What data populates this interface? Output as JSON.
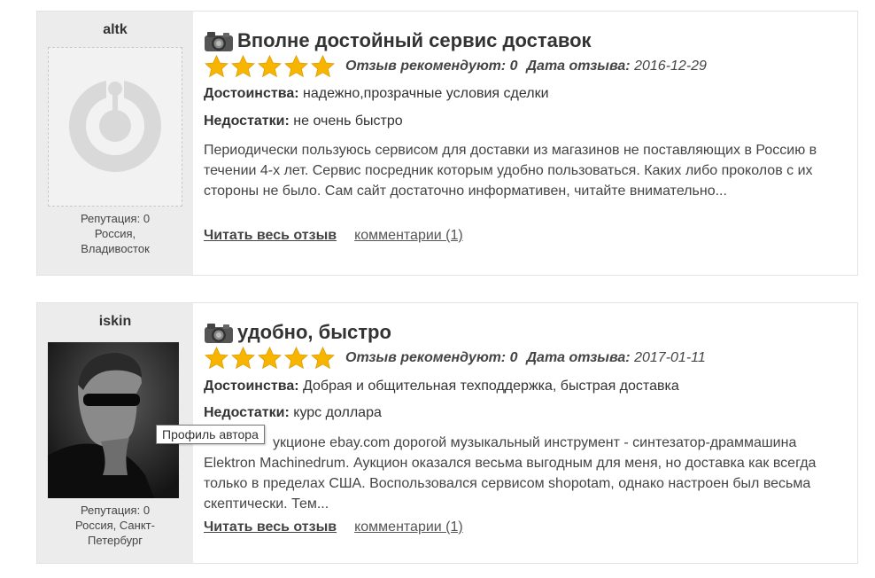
{
  "reviews": [
    {
      "author": {
        "name": "altk",
        "reputation": "Репутация: 0",
        "location": "Россия,\nВладивосток",
        "avatar": "default-avatar-icon"
      },
      "title": "Вполне достойный сервис доставок",
      "stars": 5,
      "recommend_label": "Отзыв рекомендуют:",
      "recommend_value": "0",
      "date_label": "Дата отзыва:",
      "date_value": "2016-12-29",
      "pros_label": "Достоинства:",
      "pros_value": "надежно,прозрачные условия сделки",
      "cons_label": "Недостатки:",
      "cons_value": "не очень быстро",
      "body": "Периодически пользуюсь сервисом для доставки из магазинов не поставляющих в Россию в течении 4-х лет. Сервис посредник которым удобно пользоваться. Каких либо проколов с их стороны не было. Сам сайт достаточно информативен, читайте внимательно...",
      "read_more": "Читать весь отзыв",
      "comments": "комментарии (1)"
    },
    {
      "author": {
        "name": "iskin",
        "reputation": "Репутация: 0",
        "location": "Россия, Санкт-\nПетербург",
        "avatar": "user-photo"
      },
      "title": "удобно, быстро",
      "stars": 5,
      "recommend_label": "Отзыв рекомендуют:",
      "recommend_value": "0",
      "date_label": "Дата отзыва:",
      "date_value": "2017-01-11",
      "pros_label": "Достоинства:",
      "pros_value": "Добрая и общительная техподдержка, быстрая доставка",
      "cons_label": "Недостатки:",
      "cons_value": "курс доллара",
      "body": "укционе ebay.com дорогой музыкальный инструмент - синтезатор-драммашина Elektron Machinedrum. Аукцион оказался весьма выгодным для меня, но доставка как всегда только в пределах США. Воспользовался сервисом shopotam, однако настроен был весьма скептически. Тем...",
      "read_more": "Читать весь отзыв",
      "comments": "комментарии (1)"
    }
  ],
  "tooltip": "Профиль автора",
  "colors": {
    "star": "#f7b500",
    "panel": "#ececec",
    "border": "#e3e3e3"
  }
}
